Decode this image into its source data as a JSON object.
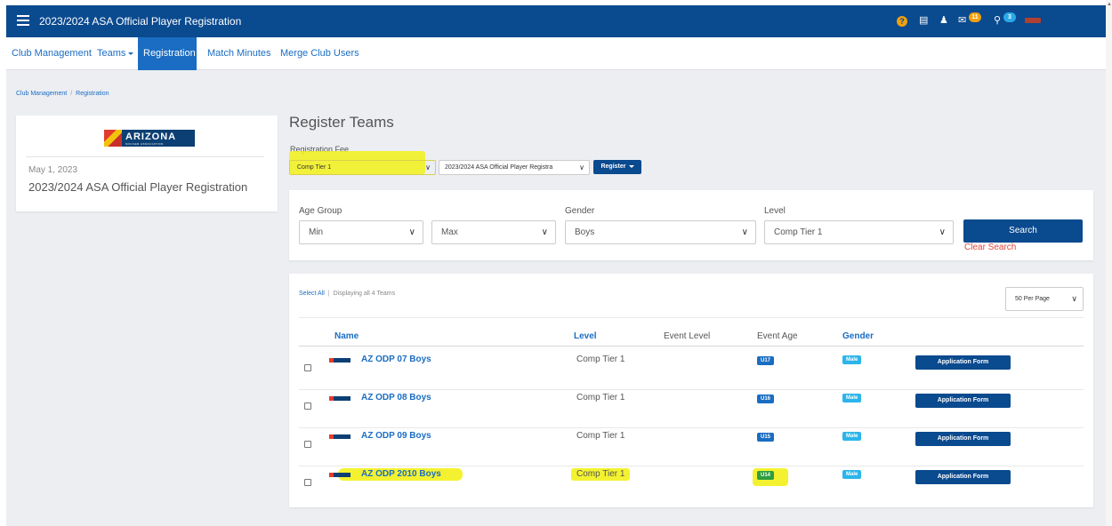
{
  "topbar": {
    "title": "2023/2024 ASA Official Player Registration",
    "help_label": "?",
    "mail_badge": "11",
    "chat_badge": "3"
  },
  "nav": {
    "items": [
      "Club Management",
      "Teams",
      "Registration",
      "Match Minutes",
      "Merge Club Users"
    ]
  },
  "breadcrumb": [
    "Club Management",
    "Registration"
  ],
  "event_card": {
    "logo_text": "ARIZONA",
    "logo_sub": "SOCCER ASSOCIATION",
    "date": "May 1, 2023",
    "title": "2023/2024 ASA Official Player Registration"
  },
  "register": {
    "heading": "Register Teams",
    "fee_label": "Registration Fee",
    "fee_value": "Comp Tier 1",
    "event_value": "2023/2024 ASA Official Player Registra",
    "register_button": "Register"
  },
  "filters": {
    "age_group_label": "Age Group",
    "age_min": "Min",
    "age_max": "Max",
    "gender_label": "Gender",
    "gender_value": "Boys",
    "level_label": "Level",
    "level_value": "Comp Tier 1",
    "search_button": "Search",
    "clear_search": "Clear Search"
  },
  "teams_table": {
    "select_all": "Select All",
    "displaying": "Displaying all 4 Teams",
    "per_page": "50 Per Page",
    "headers": {
      "name": "Name",
      "level": "Level",
      "event_level": "Event Level",
      "event_age": "Event Age",
      "gender": "Gender"
    },
    "rows": [
      {
        "name": "AZ ODP 07 Boys",
        "level": "Comp Tier 1",
        "age": "U17",
        "gender": "Male",
        "action": "Application Form"
      },
      {
        "name": "AZ ODP 08 Boys",
        "level": "Comp Tier 1",
        "age": "U16",
        "gender": "Male",
        "action": "Application Form"
      },
      {
        "name": "AZ ODP 09 Boys",
        "level": "Comp Tier 1",
        "age": "U15",
        "gender": "Male",
        "action": "Application Form"
      },
      {
        "name": "AZ ODP 2010 Boys",
        "level": "Comp Tier 1",
        "age": "U14",
        "gender": "Male",
        "action": "Application Form"
      }
    ]
  },
  "colors": {
    "primary": "#0a4a8f",
    "link": "#1a6dc2",
    "highlight": "#f3f11a",
    "badge_orange": "#f0a10e",
    "danger": "#e0453a"
  }
}
